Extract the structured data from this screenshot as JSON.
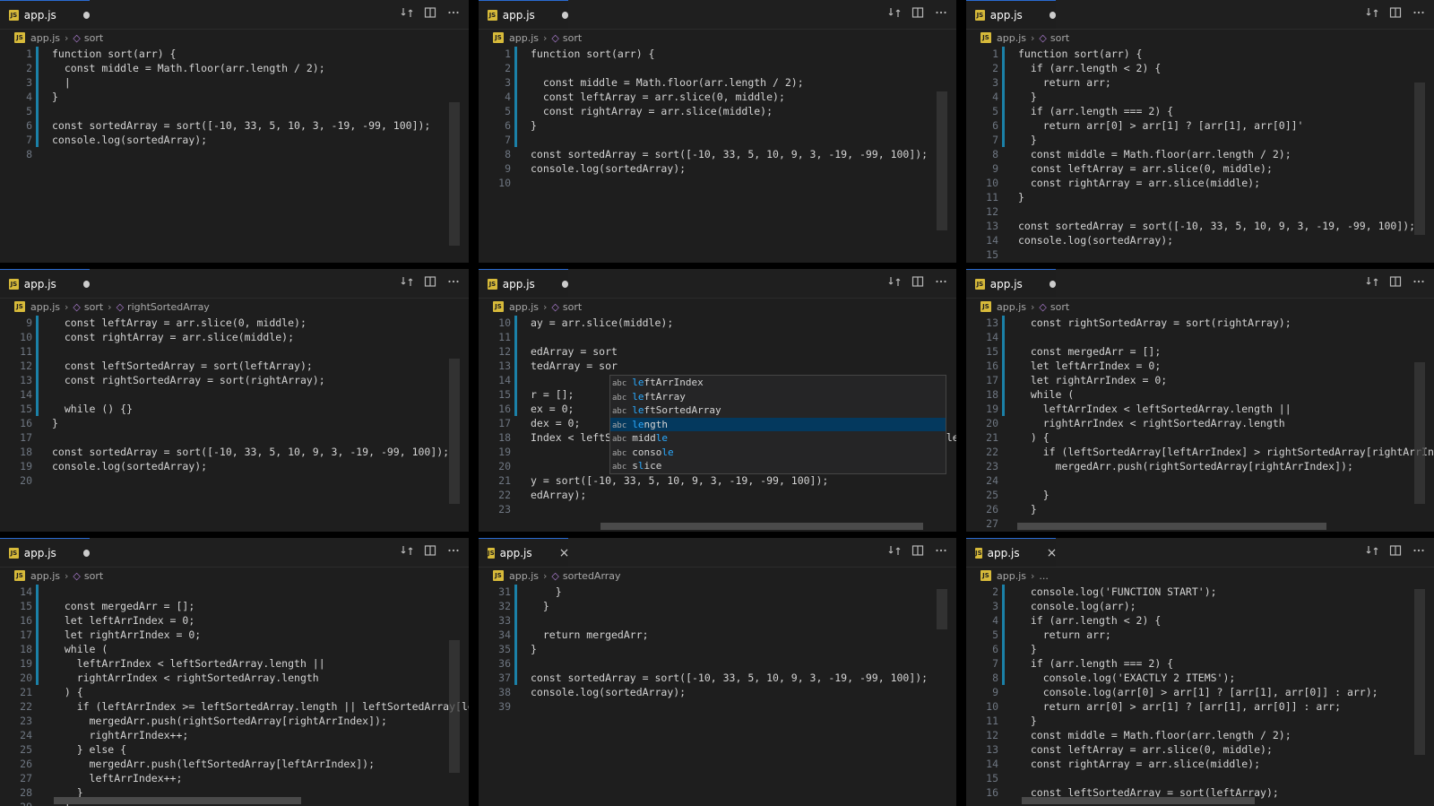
{
  "window": {
    "tab_label": "app.js",
    "icon_label": "JS",
    "close_glyph": "×",
    "file_name": "app.js",
    "crumb_sep": "›",
    "accent_color": "#2a6bd1",
    "bg_color": "#1e1e1e"
  },
  "panes": [
    {
      "tab": "dirty",
      "breadcrumb": [
        "sort"
      ],
      "lines": [
        {
          "n": "1",
          "t": "function sort(arr) {"
        },
        {
          "n": "2",
          "t": "  const middle = Math.floor(arr.length / 2);"
        },
        {
          "n": "3",
          "t": "  |"
        },
        {
          "n": "4",
          "t": "}"
        },
        {
          "n": "5",
          "t": ""
        },
        {
          "n": "6",
          "t": "const sortedArray = sort([-10, 33, 5, 10, 3, -19, -99, 100]);"
        },
        {
          "n": "7",
          "t": "console.log(sortedArray);"
        },
        {
          "n": "8",
          "t": ""
        }
      ]
    },
    {
      "tab": "dirty",
      "breadcrumb": [
        "sort"
      ],
      "lines": [
        {
          "n": "1",
          "t": "function sort(arr) {"
        },
        {
          "n": "2",
          "t": ""
        },
        {
          "n": "3",
          "t": "  const middle = Math.floor(arr.length / 2);"
        },
        {
          "n": "4",
          "t": "  const leftArray = arr.slice(0, middle);"
        },
        {
          "n": "5",
          "t": "  const rightArray = arr.slice(middle);"
        },
        {
          "n": "6",
          "t": "}"
        },
        {
          "n": "7",
          "t": ""
        },
        {
          "n": "8",
          "t": "const sortedArray = sort([-10, 33, 5, 10, 9, 3, -19, -99, 100]);"
        },
        {
          "n": "9",
          "t": "console.log(sortedArray);"
        },
        {
          "n": "10",
          "t": ""
        }
      ]
    },
    {
      "tab": "dirty",
      "breadcrumb": [
        "sort"
      ],
      "lines": [
        {
          "n": "1",
          "t": "function sort(arr) {"
        },
        {
          "n": "2",
          "t": "  if (arr.length < 2) {"
        },
        {
          "n": "3",
          "t": "    return arr;"
        },
        {
          "n": "4",
          "t": "  }"
        },
        {
          "n": "5",
          "t": "  if (arr.length === 2) {"
        },
        {
          "n": "6",
          "t": "    return arr[0] > arr[1] ? [arr[1], arr[0]]'"
        },
        {
          "n": "7",
          "t": "  }"
        },
        {
          "n": "8",
          "t": "  const middle = Math.floor(arr.length / 2);"
        },
        {
          "n": "9",
          "t": "  const leftArray = arr.slice(0, middle);"
        },
        {
          "n": "10",
          "t": "  const rightArray = arr.slice(middle);"
        },
        {
          "n": "11",
          "t": "}"
        },
        {
          "n": "12",
          "t": ""
        },
        {
          "n": "13",
          "t": "const sortedArray = sort([-10, 33, 5, 10, 9, 3, -19, -99, 100]);"
        },
        {
          "n": "14",
          "t": "console.log(sortedArray);"
        },
        {
          "n": "15",
          "t": ""
        }
      ]
    },
    {
      "tab": "dirty",
      "breadcrumb": [
        "sort",
        "rightSortedArray"
      ],
      "lines": [
        {
          "n": "9",
          "t": "  const leftArray = arr.slice(0, middle);"
        },
        {
          "n": "10",
          "t": "  const rightArray = arr.slice(middle);"
        },
        {
          "n": "11",
          "t": ""
        },
        {
          "n": "12",
          "t": "  const leftSortedArray = sort(leftArray);"
        },
        {
          "n": "13",
          "t": "  const rightSortedArray = sort(rightArray);"
        },
        {
          "n": "14",
          "t": ""
        },
        {
          "n": "15",
          "t": "  while () {}"
        },
        {
          "n": "16",
          "t": "}"
        },
        {
          "n": "17",
          "t": ""
        },
        {
          "n": "18",
          "t": "const sortedArray = sort([-10, 33, 5, 10, 9, 3, -19, -99, 100]);"
        },
        {
          "n": "19",
          "t": "console.log(sortedArray);"
        },
        {
          "n": "20",
          "t": ""
        }
      ]
    },
    {
      "tab": "dirty",
      "breadcrumb": [
        "sort"
      ],
      "lines": [
        {
          "n": "10",
          "t": "ay = arr.slice(middle);"
        },
        {
          "n": "11",
          "t": ""
        },
        {
          "n": "12",
          "t": "edArray = sort"
        },
        {
          "n": "13",
          "t": "tedArray = sor"
        },
        {
          "n": "14",
          "t": ""
        },
        {
          "n": "15",
          "t": "r = [];"
        },
        {
          "n": "16",
          "t": "ex = 0;"
        },
        {
          "n": "17",
          "t": "dex = 0;"
        },
        {
          "n": "18",
          "t": "Index < leftSortedArray.length || rightArrIndex < rightSortedArray.le| {}"
        },
        {
          "n": "19",
          "t": ""
        },
        {
          "n": "20",
          "t": ""
        },
        {
          "n": "21",
          "t": "y = sort([-10, 33, 5, 10, 9, 3, -19, -99, 100]);"
        },
        {
          "n": "22",
          "t": "edArray);"
        },
        {
          "n": "23",
          "t": ""
        }
      ],
      "suggest": [
        {
          "pre": "",
          "match": "le",
          "rest": "ftArrIndex"
        },
        {
          "pre": "",
          "match": "le",
          "rest": "ftArray"
        },
        {
          "pre": "",
          "match": "le",
          "rest": "ftSortedArray"
        },
        {
          "pre": "",
          "match": "le",
          "rest": "ngth"
        },
        {
          "pre": "midd",
          "match": "le",
          "rest": ""
        },
        {
          "pre": "conso",
          "match": "le",
          "rest": ""
        },
        {
          "pre": "s",
          "match": "l",
          "rest": "ice"
        }
      ],
      "suggest_kind": "abc"
    },
    {
      "tab": "dirty",
      "breadcrumb": [
        "sort"
      ],
      "lines": [
        {
          "n": "13",
          "t": "  const rightSortedArray = sort(rightArray);"
        },
        {
          "n": "14",
          "t": ""
        },
        {
          "n": "15",
          "t": "  const mergedArr = [];"
        },
        {
          "n": "16",
          "t": "  let leftArrIndex = 0;"
        },
        {
          "n": "17",
          "t": "  let rightArrIndex = 0;"
        },
        {
          "n": "18",
          "t": "  while ("
        },
        {
          "n": "19",
          "t": "    leftArrIndex < leftSortedArray.length ||"
        },
        {
          "n": "20",
          "t": "    rightArrIndex < rightSortedArray.length"
        },
        {
          "n": "21",
          "t": "  ) {"
        },
        {
          "n": "22",
          "t": "    if (leftSortedArray[leftArrIndex] > rightSortedArray[rightArrIndex]) {"
        },
        {
          "n": "23",
          "t": "      mergedArr.push(rightSortedArray[rightArrIndex]);"
        },
        {
          "n": "24",
          "t": ""
        },
        {
          "n": "25",
          "t": "    }"
        },
        {
          "n": "26",
          "t": "  }"
        },
        {
          "n": "27",
          "t": ""
        }
      ]
    },
    {
      "tab": "dirty",
      "breadcrumb": [
        "sort"
      ],
      "lines": [
        {
          "n": "14",
          "t": ""
        },
        {
          "n": "15",
          "t": "  const mergedArr = [];"
        },
        {
          "n": "16",
          "t": "  let leftArrIndex = 0;"
        },
        {
          "n": "17",
          "t": "  let rightArrIndex = 0;"
        },
        {
          "n": "18",
          "t": "  while ("
        },
        {
          "n": "19",
          "t": "    leftArrIndex < leftSortedArray.length ||"
        },
        {
          "n": "20",
          "t": "    rightArrIndex < rightSortedArray.length"
        },
        {
          "n": "21",
          "t": "  ) {"
        },
        {
          "n": "22",
          "t": "    if (leftArrIndex >= leftSortedArray.length || leftSortedArray[leftArr"
        },
        {
          "n": "23",
          "t": "      mergedArr.push(rightSortedArray[rightArrIndex]);"
        },
        {
          "n": "24",
          "t": "      rightArrIndex++;"
        },
        {
          "n": "25",
          "t": "    } else {"
        },
        {
          "n": "26",
          "t": "      mergedArr.push(leftSortedArray[leftArrIndex]);"
        },
        {
          "n": "27",
          "t": "      leftArrIndex++;"
        },
        {
          "n": "28",
          "t": "    }"
        },
        {
          "n": "29",
          "t": "  }"
        }
      ]
    },
    {
      "tab": "close",
      "breadcrumb": [
        "sortedArray"
      ],
      "lines": [
        {
          "n": "31",
          "t": "    }"
        },
        {
          "n": "32",
          "t": "  }"
        },
        {
          "n": "33",
          "t": ""
        },
        {
          "n": "34",
          "t": "  return mergedArr;"
        },
        {
          "n": "35",
          "t": "}"
        },
        {
          "n": "36",
          "t": ""
        },
        {
          "n": "37",
          "t": "const sortedArray = sort([-10, 33, 5, 10, 9, 3, -19, -99, 100]);"
        },
        {
          "n": "38",
          "t": "console.log(sortedArray);"
        },
        {
          "n": "39",
          "t": ""
        }
      ]
    },
    {
      "tab": "close",
      "breadcrumb": [
        "..."
      ],
      "lines": [
        {
          "n": "2",
          "t": "  console.log('FUNCTION START');"
        },
        {
          "n": "3",
          "t": "  console.log(arr);"
        },
        {
          "n": "4",
          "t": "  if (arr.length < 2) {"
        },
        {
          "n": "5",
          "t": "    return arr;"
        },
        {
          "n": "6",
          "t": "  }"
        },
        {
          "n": "7",
          "t": "  if (arr.length === 2) {"
        },
        {
          "n": "8",
          "t": "    console.log('EXACTLY 2 ITEMS');"
        },
        {
          "n": "9",
          "t": "    console.log(arr[0] > arr[1] ? [arr[1], arr[0]] : arr);"
        },
        {
          "n": "10",
          "t": "    return arr[0] > arr[1] ? [arr[1], arr[0]] : arr;"
        },
        {
          "n": "11",
          "t": "  }"
        },
        {
          "n": "12",
          "t": "  const middle = Math.floor(arr.length / 2);"
        },
        {
          "n": "13",
          "t": "  const leftArray = arr.slice(0, middle);"
        },
        {
          "n": "14",
          "t": "  const rightArray = arr.slice(middle);"
        },
        {
          "n": "15",
          "t": ""
        },
        {
          "n": "16",
          "t": "  const leftSortedArray = sort(leftArray);"
        }
      ]
    }
  ]
}
